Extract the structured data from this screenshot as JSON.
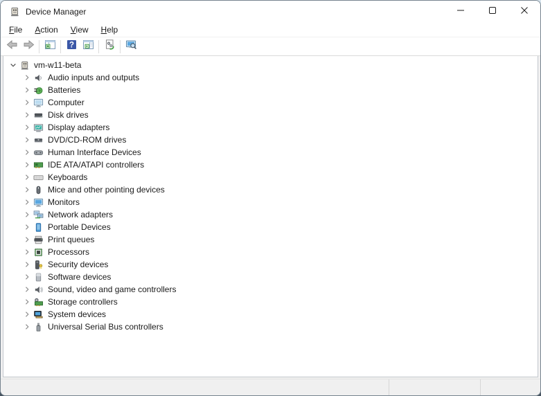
{
  "window": {
    "title": "Device Manager",
    "app_icon": "device-manager-icon",
    "controls": [
      {
        "name": "minimize",
        "icon": "minimize-icon"
      },
      {
        "name": "maximize",
        "icon": "maximize-icon"
      },
      {
        "name": "close",
        "icon": "close-icon"
      }
    ]
  },
  "menu": {
    "items": [
      {
        "label": "File",
        "accesskey": "F"
      },
      {
        "label": "Action",
        "accesskey": "A"
      },
      {
        "label": "View",
        "accesskey": "V"
      },
      {
        "label": "Help",
        "accesskey": "H"
      }
    ]
  },
  "toolbar": {
    "buttons": [
      {
        "name": "back",
        "icon": "back-arrow-icon",
        "divider_after": false
      },
      {
        "name": "forward",
        "icon": "forward-arrow-icon",
        "divider_after": true
      },
      {
        "name": "show-hide-console-tree",
        "icon": "console-tree-icon",
        "divider_after": true
      },
      {
        "name": "help",
        "icon": "help-icon",
        "divider_after": false
      },
      {
        "name": "show-hide-action-pane",
        "icon": "action-pane-icon",
        "divider_after": true
      },
      {
        "name": "properties",
        "icon": "gears-page-icon",
        "divider_after": true
      },
      {
        "name": "scan-for-hardware-changes",
        "icon": "scan-hardware-icon",
        "divider_after": false
      }
    ]
  },
  "tree": {
    "root": {
      "label": "vm-w11-beta",
      "icon": "pc-icon",
      "expanded": true
    },
    "items": [
      {
        "label": "Audio inputs and outputs",
        "icon": "audio-endpoint-icon"
      },
      {
        "label": "Batteries",
        "icon": "battery-icon"
      },
      {
        "label": "Computer",
        "icon": "computer-icon"
      },
      {
        "label": "Disk drives",
        "icon": "disk-drive-icon"
      },
      {
        "label": "Display adapters",
        "icon": "display-adapter-icon"
      },
      {
        "label": "DVD/CD-ROM drives",
        "icon": "dvd-drive-icon"
      },
      {
        "label": "Human Interface Devices",
        "icon": "hid-icon"
      },
      {
        "label": "IDE ATA/ATAPI controllers",
        "icon": "ide-controller-icon"
      },
      {
        "label": "Keyboards",
        "icon": "keyboard-icon"
      },
      {
        "label": "Mice and other pointing devices",
        "icon": "mouse-icon"
      },
      {
        "label": "Monitors",
        "icon": "monitor-icon"
      },
      {
        "label": "Network adapters",
        "icon": "network-adapter-icon"
      },
      {
        "label": "Portable Devices",
        "icon": "portable-device-icon"
      },
      {
        "label": "Print queues",
        "icon": "printer-icon"
      },
      {
        "label": "Processors",
        "icon": "processor-icon"
      },
      {
        "label": "Security devices",
        "icon": "security-device-icon"
      },
      {
        "label": "Software devices",
        "icon": "software-device-icon"
      },
      {
        "label": "Sound, video and game controllers",
        "icon": "sound-controller-icon"
      },
      {
        "label": "Storage controllers",
        "icon": "storage-controller-icon"
      },
      {
        "label": "System devices",
        "icon": "system-device-icon"
      },
      {
        "label": "Universal Serial Bus controllers",
        "icon": "usb-controller-icon"
      }
    ]
  },
  "statusbar": {
    "sections": [
      "",
      "",
      ""
    ]
  },
  "colors": {
    "accent_help_blue": "#3a57a7",
    "device_green": "#4f9e4f",
    "monitor_blue": "#5aa7e0",
    "key_yellow": "#e6c84a",
    "chrome_white": "#ffffff",
    "statusbar_gray": "#f0f0f0"
  }
}
